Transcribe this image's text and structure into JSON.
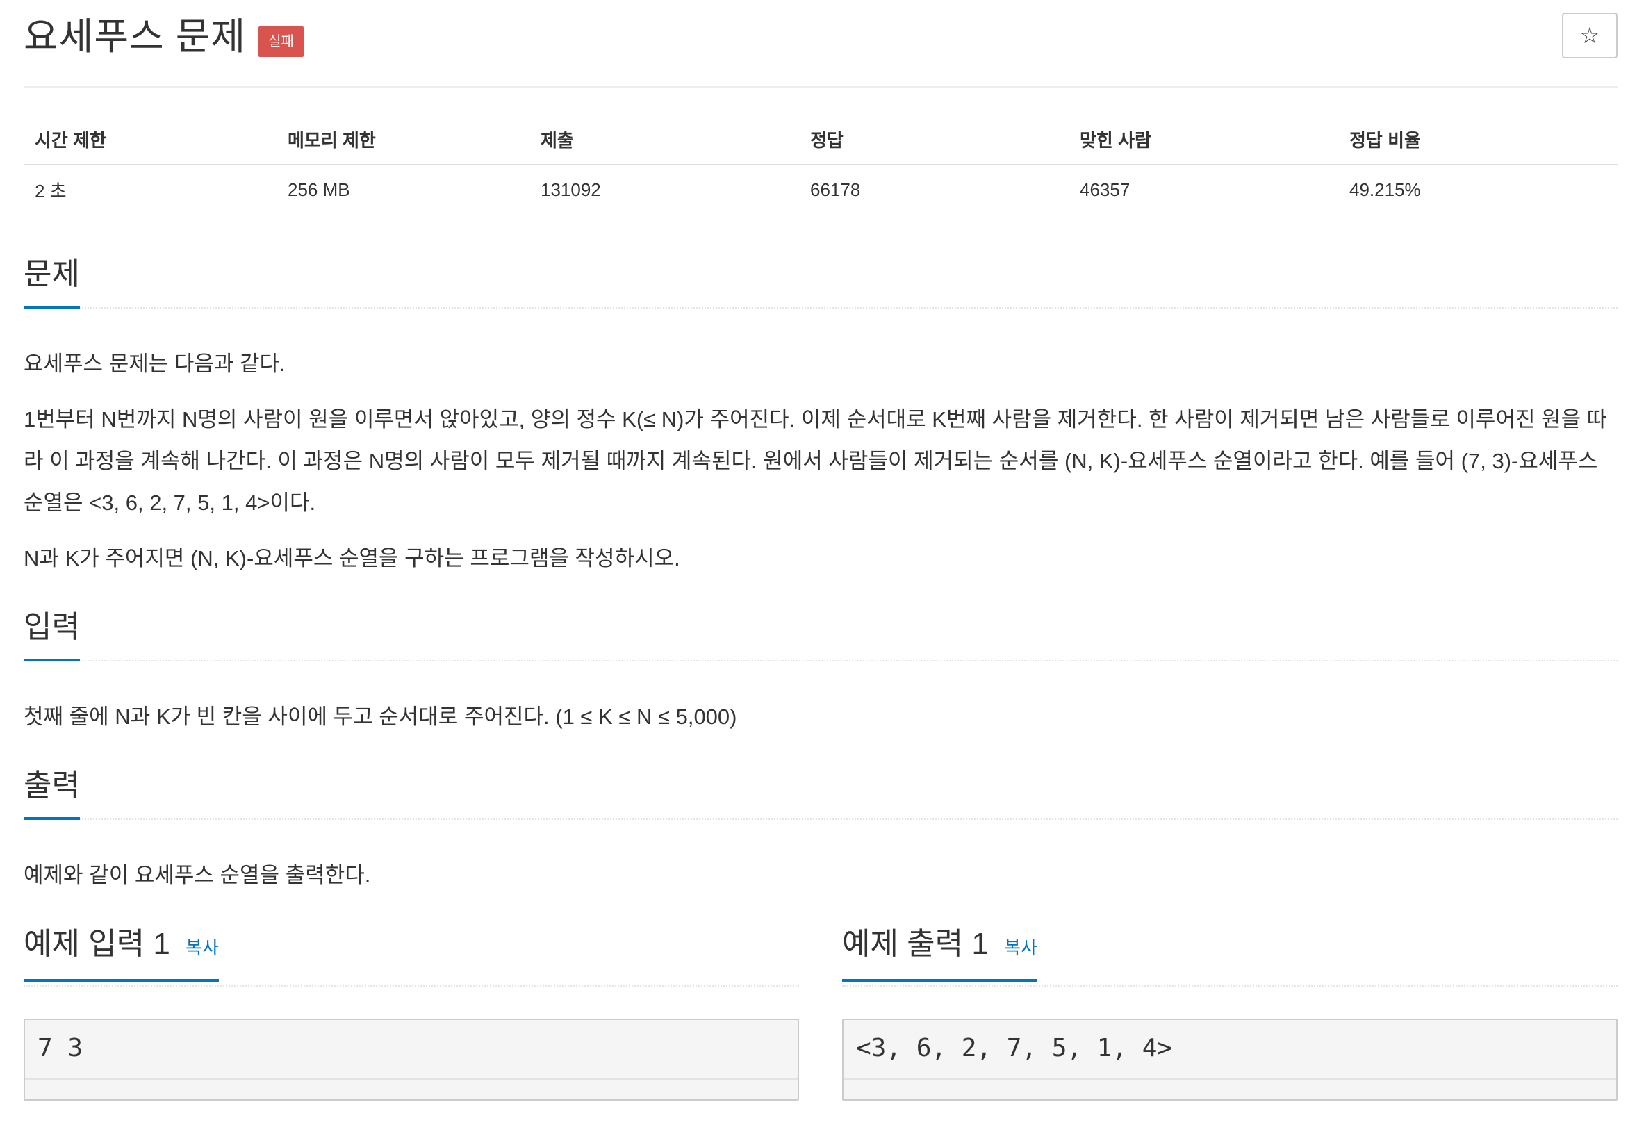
{
  "problem": {
    "title": "요세푸스 문제",
    "status_badge": "실패",
    "star_icon": "☆"
  },
  "info_table": {
    "headers": [
      "시간 제한",
      "메모리 제한",
      "제출",
      "정답",
      "맞힌 사람",
      "정답 비율"
    ],
    "values": [
      "2 초",
      "256 MB",
      "131092",
      "66178",
      "46357",
      "49.215%"
    ]
  },
  "sections": {
    "description": {
      "title": "문제",
      "paragraphs": [
        "요세푸스 문제는 다음과 같다.",
        "1번부터 N번까지 N명의 사람이 원을 이루면서 앉아있고, 양의 정수 K(≤ N)가 주어진다. 이제 순서대로 K번째 사람을 제거한다. 한 사람이 제거되면 남은 사람들로 이루어진 원을 따라 이 과정을 계속해 나간다. 이 과정은 N명의 사람이 모두 제거될 때까지 계속된다. 원에서 사람들이 제거되는 순서를 (N, K)-요세푸스 순열이라고 한다. 예를 들어 (7, 3)-요세푸스 순열은 <3, 6, 2, 7, 5, 1, 4>이다.",
        "N과 K가 주어지면 (N, K)-요세푸스 순열을 구하는 프로그램을 작성하시오."
      ]
    },
    "input": {
      "title": "입력",
      "text": "첫째 줄에 N과 K가 빈 칸을 사이에 두고 순서대로 주어진다. (1 ≤ K ≤ N ≤ 5,000)"
    },
    "output": {
      "title": "출력",
      "text": "예제와 같이 요세푸스 순열을 출력한다."
    }
  },
  "samples": {
    "input": {
      "title": "예제 입력 1",
      "copy_label": "복사",
      "content": "7 3"
    },
    "output": {
      "title": "예제 출력 1",
      "copy_label": "복사",
      "content": "<3, 6, 2, 7, 5, 1, 4>"
    }
  }
}
